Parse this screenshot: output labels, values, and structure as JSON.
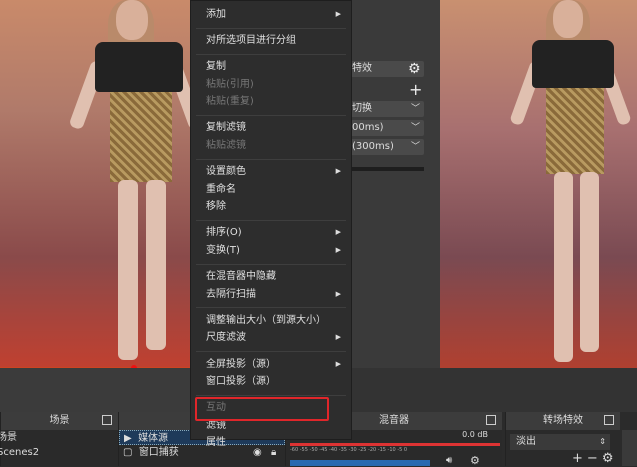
{
  "context_menu": {
    "items": [
      {
        "label": "添加",
        "submenu": true
      },
      {
        "sep": true
      },
      {
        "label": "对所选项目进行分组"
      },
      {
        "sep": true
      },
      {
        "label": "复制"
      },
      {
        "label": "粘贴(引用)",
        "disabled": true
      },
      {
        "label": "粘贴(重复)",
        "disabled": true
      },
      {
        "sep": true
      },
      {
        "label": "复制滤镜"
      },
      {
        "label": "粘贴滤镜",
        "disabled": true
      },
      {
        "sep": true
      },
      {
        "label": "设置颜色",
        "submenu": true
      },
      {
        "label": "重命名"
      },
      {
        "label": "移除"
      },
      {
        "sep": true
      },
      {
        "label": "排序(O)",
        "submenu": true
      },
      {
        "label": "变换(T)",
        "submenu": true
      },
      {
        "sep": true
      },
      {
        "label": "在混音器中隐藏"
      },
      {
        "label": "去隔行扫描",
        "submenu": true
      },
      {
        "sep": true
      },
      {
        "label": "调整输出大小（到源大小）"
      },
      {
        "label": "尺度滤波",
        "submenu": true
      },
      {
        "sep": true
      },
      {
        "label": "全屏投影（源）",
        "submenu": true
      },
      {
        "label": "窗口投影（源）"
      },
      {
        "sep": true
      },
      {
        "label": "互动",
        "disabled": true
      },
      {
        "label": "滤镜",
        "highlighted": true
      },
      {
        "label": "属性"
      }
    ]
  },
  "middle_panel": {
    "fields": [
      "特效",
      "切换",
      "00ms)",
      "(300ms)"
    ]
  },
  "docks": {
    "scenes": {
      "title": "场景",
      "items": [
        "场景",
        "Scenes2"
      ]
    },
    "sources": {
      "title": "来源",
      "items": [
        {
          "label": "媒体源",
          "icon": "play-icon",
          "selected": true
        },
        {
          "label": "窗口捕获",
          "icon": "window-icon"
        }
      ]
    },
    "mixer": {
      "title": "混音器",
      "level": "0.0 dB",
      "ticks": "-60 -55 -50 -45 -40 -35 -30 -25 -20 -15 -10 -5 0"
    },
    "transitions": {
      "title": "转场特效",
      "selected": "淡出"
    }
  },
  "colors": {
    "highlight_box": "#e0262a",
    "menu_bg": "#2d2d2d"
  }
}
